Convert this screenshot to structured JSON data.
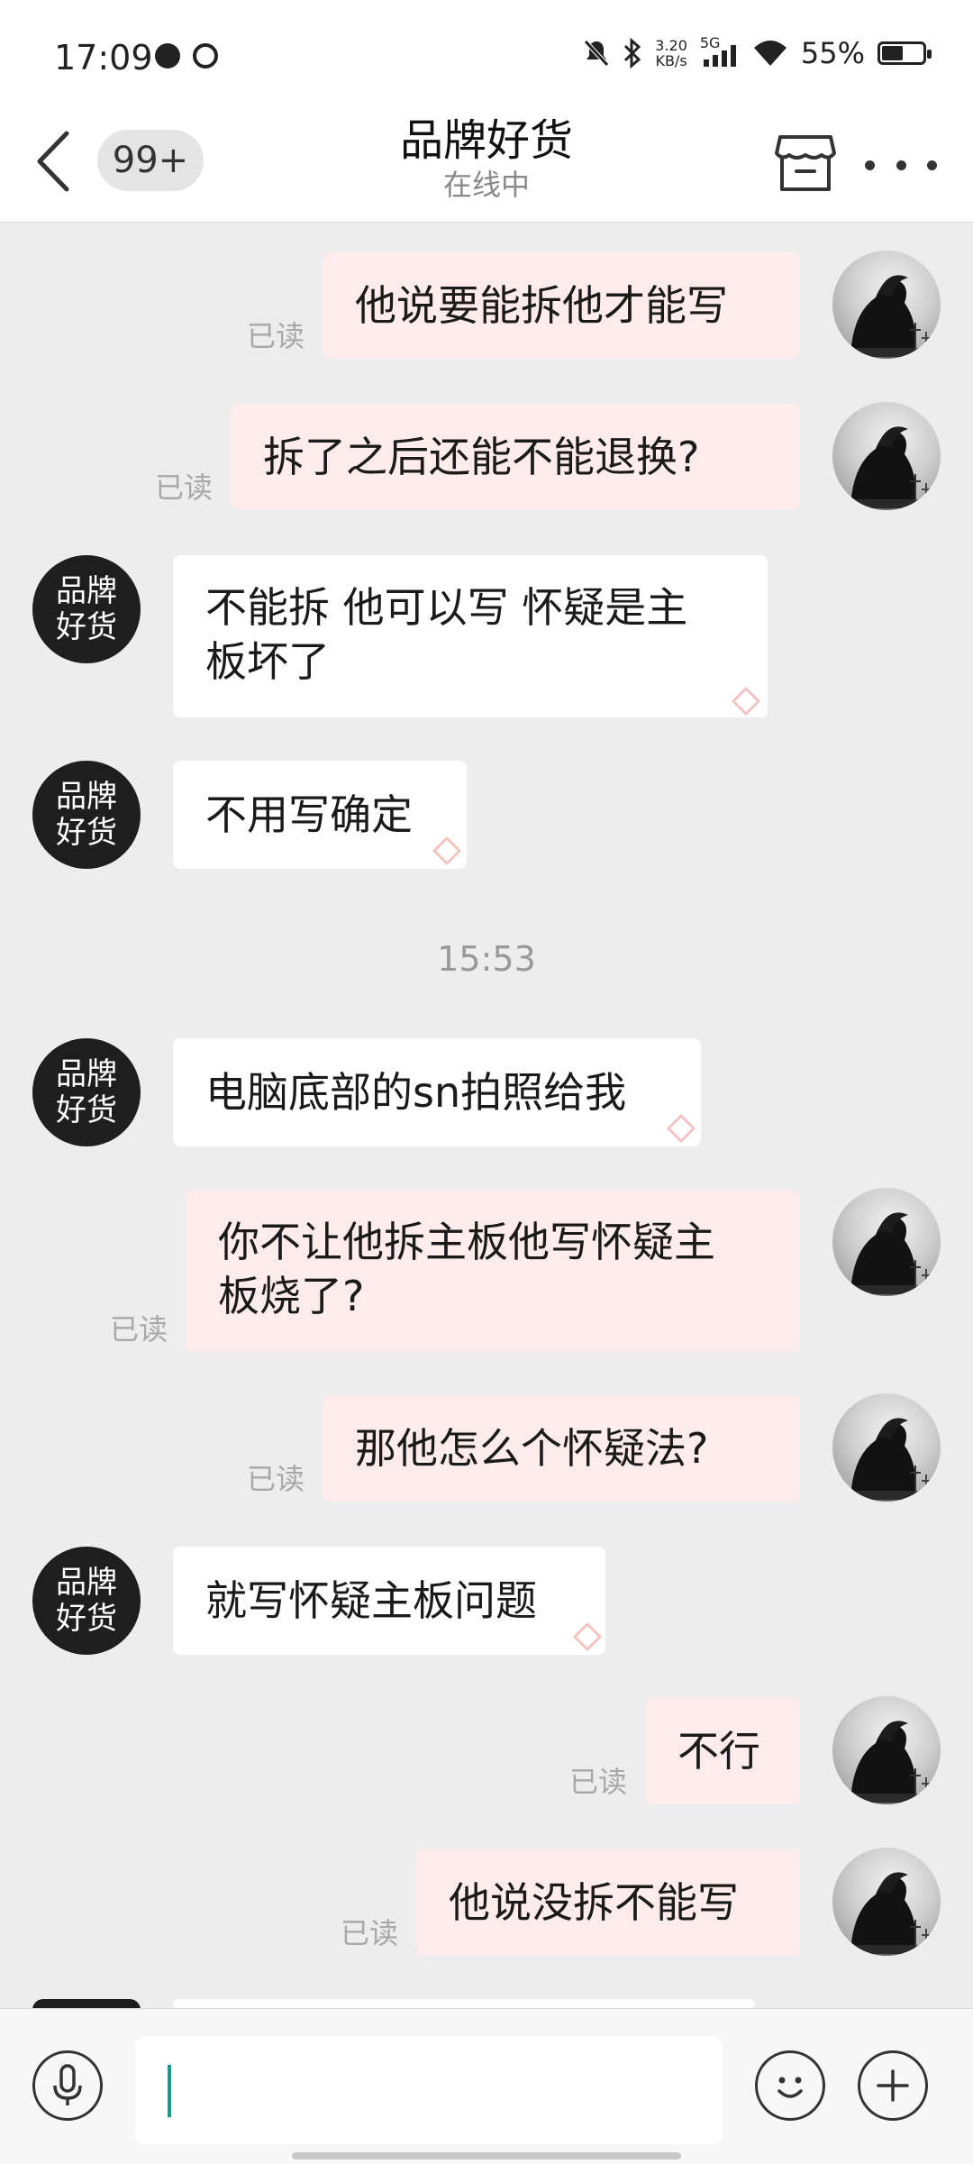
{
  "status_bar": {
    "time": "17:09",
    "net_speed_value": "3.20",
    "net_speed_unit": "KB/s",
    "network": "5G",
    "battery_percent": "55%",
    "battery_level": 0.55,
    "icons": [
      "location-icon",
      "timer-icon",
      "mute-icon",
      "bluetooth-icon",
      "signal-icon",
      "wifi-icon",
      "battery-icon"
    ]
  },
  "header": {
    "unread_count": "99+",
    "title": "品牌好货",
    "status": "在线中",
    "icons": [
      "back-arrow-icon",
      "store-icon",
      "more-icon"
    ]
  },
  "shop_avatar": {
    "line1": "品牌",
    "line2": "好货"
  },
  "messages": [
    {
      "side": "out",
      "text": "他说要能拆他才能写",
      "read": "已读"
    },
    {
      "side": "out",
      "text": "拆了之后还能不能退换?",
      "read": "已读"
    },
    {
      "side": "in",
      "line1": "不能拆 他可以写 怀疑是主",
      "line2": "板坏了"
    },
    {
      "side": "in",
      "text": "不用写确定"
    },
    {
      "side": "in",
      "text": "电脑底部的sn拍照给我"
    },
    {
      "side": "out",
      "line1": "你不让他拆主板他写怀疑主",
      "line2": "板烧了?",
      "read": "已读"
    },
    {
      "side": "out",
      "text": "那他怎么个怀疑法?",
      "read": "已读"
    },
    {
      "side": "in",
      "text": "就写怀疑主板问题"
    },
    {
      "side": "out",
      "text": "不行",
      "read": "已读"
    },
    {
      "side": "out",
      "text": "他说没拆不能写",
      "read": "已读"
    }
  ],
  "timestamp": "15:53",
  "colors": {
    "outgoing_bubble": "#fdeceb",
    "incoming_bubble": "#ffffff",
    "background": "#ededed",
    "cursor": "#1b9a8c"
  },
  "input": {
    "value": "",
    "placeholder": ""
  },
  "bottom_icons": [
    "microphone-icon",
    "emoji-icon",
    "plus-icon"
  ]
}
